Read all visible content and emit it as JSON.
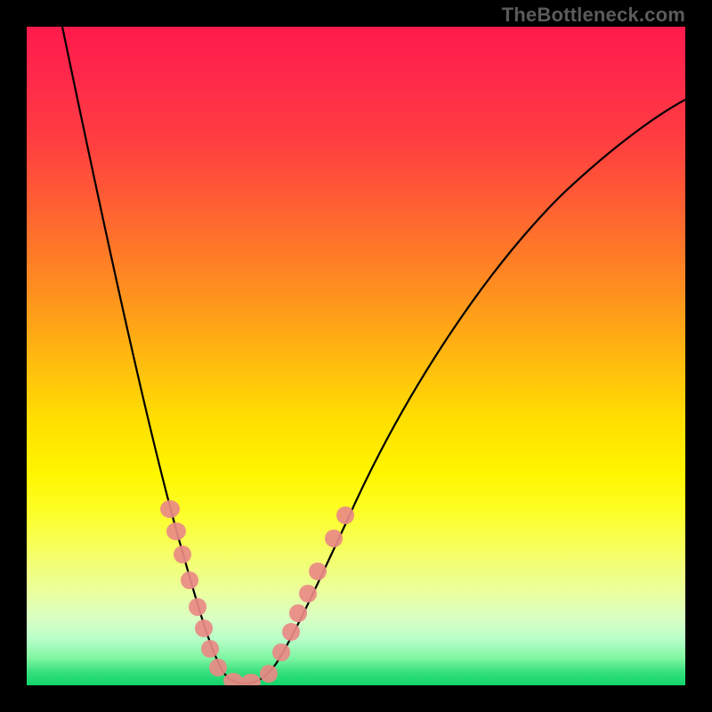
{
  "watermark": "TheBottleneck.com",
  "colors": {
    "gradient_top": "#ff1a4d",
    "gradient_mid": "#ffe000",
    "gradient_bottom": "#11d46a",
    "frame": "#000000",
    "curve": "#000000",
    "dots": "#e98a86",
    "watermark_text": "#5b5b5b"
  },
  "chart_data": {
    "type": "line",
    "title": "",
    "xlabel": "",
    "ylabel": "",
    "xlim": [
      0,
      100
    ],
    "ylim": [
      0,
      100
    ],
    "grid": false,
    "legend": false,
    "annotations": [
      "TheBottleneck.com"
    ],
    "background_gradient": "vertical red→yellow→green",
    "description": "Black V-shaped bottleneck curve overlaid on a red-yellow-green gradient; pink dots near the trough on both limbs.",
    "series": [
      {
        "name": "curve",
        "style": "line",
        "x": [
          5,
          10,
          15,
          20,
          23,
          26,
          29,
          31,
          33,
          35,
          38,
          42,
          48,
          55,
          65,
          75,
          85,
          95,
          100
        ],
        "y": [
          100,
          80,
          62,
          46,
          34,
          24,
          15,
          8,
          3,
          1,
          3,
          10,
          22,
          38,
          56,
          70,
          80,
          87,
          89
        ]
      },
      {
        "name": "dots",
        "style": "scatter",
        "x": [
          21.8,
          22.7,
          23.6,
          24.7,
          25.9,
          26.9,
          27.8,
          29.1,
          31.4,
          34.1,
          36.8,
          38.6,
          40.1,
          41.2,
          42.7,
          44.2,
          46.6,
          48.4
        ],
        "y": [
          26.8,
          23.4,
          19.9,
          15.9,
          11.9,
          8.6,
          5.5,
          2.7,
          0.7,
          0.5,
          1.8,
          5.0,
          8.1,
          10.9,
          13.9,
          17.3,
          22.3,
          25.8
        ]
      }
    ]
  }
}
